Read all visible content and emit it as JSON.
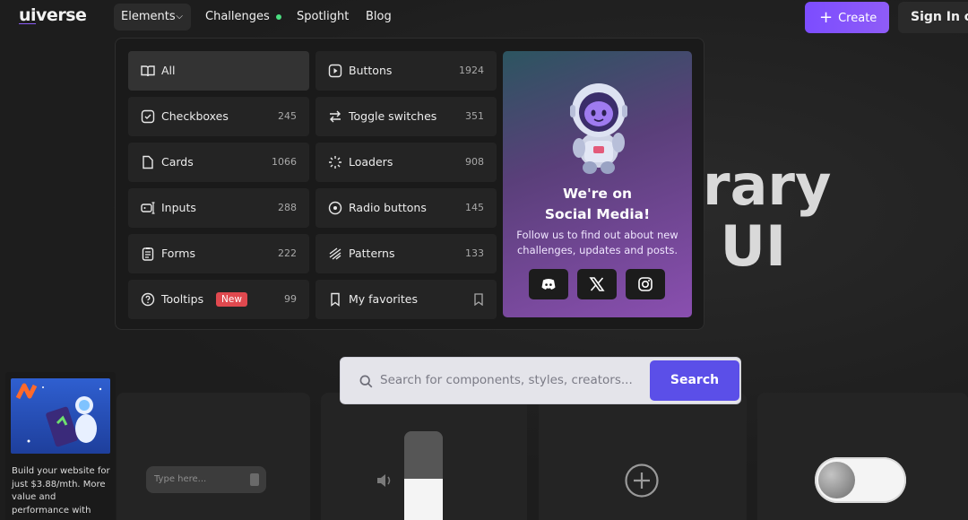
{
  "brand": {
    "logo_ui": "ui",
    "logo_rest": "verse"
  },
  "nav": {
    "elements": "Elements",
    "challenges": "Challenges",
    "spotlight": "Spotlight",
    "blog": "Blog"
  },
  "header": {
    "create": "Create",
    "sign_in": "Sign In or"
  },
  "hero": {
    "line1": "rary",
    "line2": "e UI"
  },
  "categories": [
    {
      "label": "All",
      "count": "",
      "icon": "book-icon"
    },
    {
      "label": "Buttons",
      "count": "1924",
      "icon": "button-icon"
    },
    {
      "label": "Checkboxes",
      "count": "245",
      "icon": "checkbox-icon"
    },
    {
      "label": "Toggle switches",
      "count": "351",
      "icon": "toggle-icon"
    },
    {
      "label": "Cards",
      "count": "1066",
      "icon": "card-icon"
    },
    {
      "label": "Loaders",
      "count": "908",
      "icon": "loader-icon"
    },
    {
      "label": "Inputs",
      "count": "288",
      "icon": "input-icon"
    },
    {
      "label": "Radio buttons",
      "count": "145",
      "icon": "radio-icon"
    },
    {
      "label": "Forms",
      "count": "222",
      "icon": "form-icon"
    },
    {
      "label": "Patterns",
      "count": "133",
      "icon": "pattern-icon"
    },
    {
      "label": "Tooltips",
      "count": "99",
      "icon": "tooltip-icon",
      "badge": "New"
    },
    {
      "label": "My favorites",
      "count": "",
      "icon": "bookmark-icon"
    }
  ],
  "promo": {
    "title_1": "We're on",
    "title_2": "Social Media!",
    "desc": "Follow us to find out about new challenges, updates and posts."
  },
  "search": {
    "placeholder": "Search for components, styles, creators...",
    "button": "Search"
  },
  "cards": {
    "input_placeholder": "Type here..."
  },
  "slider": {
    "fill_percent": 52
  },
  "ad": {
    "text": "Build your website for just $3.88/mth. More value and performance with"
  },
  "colors": {
    "accent": "#7c4dff",
    "search_button": "#5b4fe8",
    "new_badge": "#e0494f",
    "online_dot": "#4ade80"
  }
}
